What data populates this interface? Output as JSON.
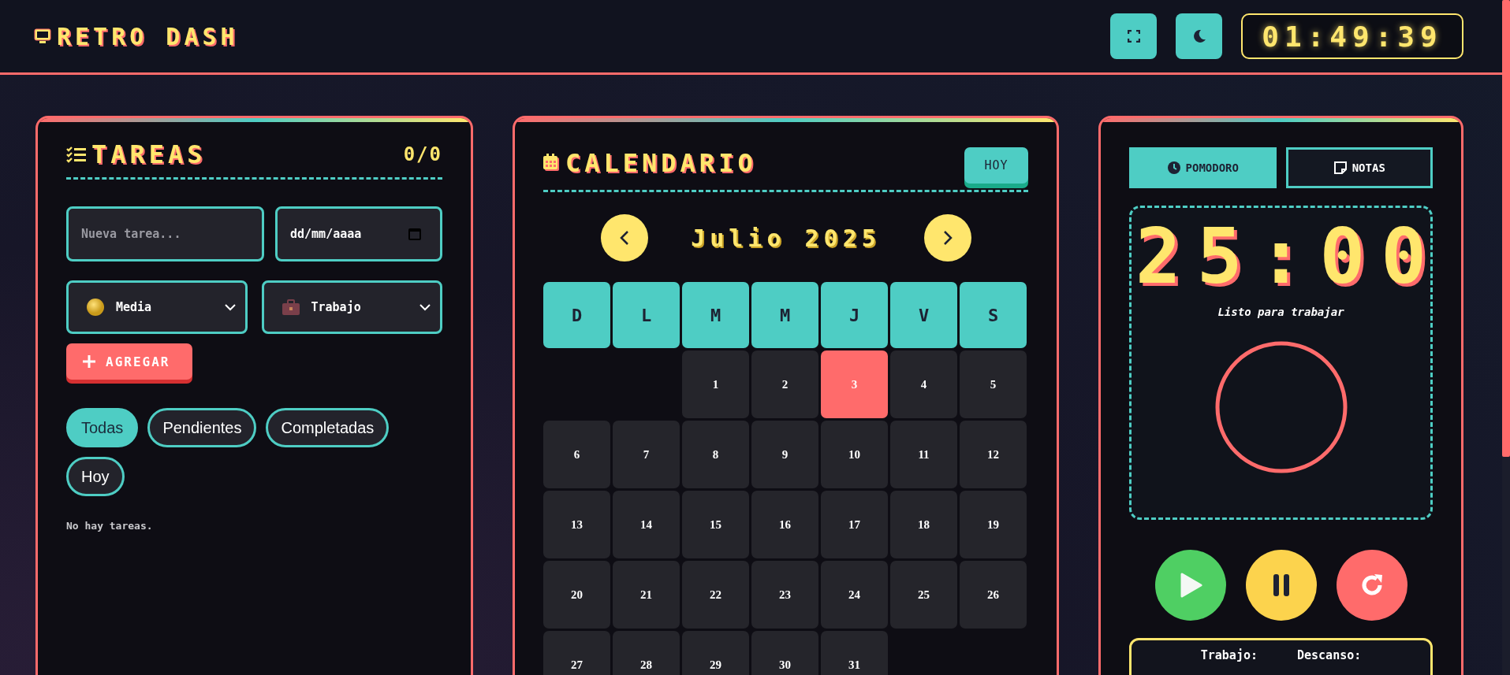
{
  "header": {
    "title": "RETRO DASH",
    "clock": "01:49:39"
  },
  "tasks": {
    "title": "TAREAS",
    "count": "0/0",
    "task_input": {
      "placeholder": "Nueva tarea..."
    },
    "date_input": {
      "placeholder": "dd/mm/aaaa"
    },
    "priority_select": {
      "value": "Media"
    },
    "category_select": {
      "value": "Trabajo"
    },
    "add_button": "AGREGAR",
    "filters": [
      {
        "label": "Todas",
        "selected": true
      },
      {
        "label": "Pendientes",
        "selected": false
      },
      {
        "label": "Completadas",
        "selected": false
      },
      {
        "label": "Hoy",
        "selected": false
      }
    ],
    "empty_message": "No hay tareas."
  },
  "calendar": {
    "title": "CALENDARIO",
    "today_button": "HOY",
    "month": "Julio 2025",
    "weekdays": [
      "D",
      "L",
      "M",
      "M",
      "J",
      "V",
      "S"
    ],
    "days": [
      {
        "kind": "blank"
      },
      {
        "kind": "blank"
      },
      {
        "kind": "day",
        "label": "1",
        "today": false
      },
      {
        "kind": "day",
        "label": "2",
        "today": false
      },
      {
        "kind": "day",
        "label": "3",
        "today": true
      },
      {
        "kind": "day",
        "label": "4",
        "today": false
      },
      {
        "kind": "day",
        "label": "5",
        "today": false
      },
      {
        "kind": "day",
        "label": "6",
        "today": false
      },
      {
        "kind": "day",
        "label": "7",
        "today": false
      },
      {
        "kind": "day",
        "label": "8",
        "today": false
      },
      {
        "kind": "day",
        "label": "9",
        "today": false
      },
      {
        "kind": "day",
        "label": "10",
        "today": false
      },
      {
        "kind": "day",
        "label": "11",
        "today": false
      },
      {
        "kind": "day",
        "label": "12",
        "today": false
      },
      {
        "kind": "day",
        "label": "13",
        "today": false
      },
      {
        "kind": "day",
        "label": "14",
        "today": false
      },
      {
        "kind": "day",
        "label": "15",
        "today": false
      },
      {
        "kind": "day",
        "label": "16",
        "today": false
      },
      {
        "kind": "day",
        "label": "17",
        "today": false
      },
      {
        "kind": "day",
        "label": "18",
        "today": false
      },
      {
        "kind": "day",
        "label": "19",
        "today": false
      },
      {
        "kind": "day",
        "label": "20",
        "today": false
      },
      {
        "kind": "day",
        "label": "21",
        "today": false
      },
      {
        "kind": "day",
        "label": "22",
        "today": false
      },
      {
        "kind": "day",
        "label": "23",
        "today": false
      },
      {
        "kind": "day",
        "label": "24",
        "today": false
      },
      {
        "kind": "day",
        "label": "25",
        "today": false
      },
      {
        "kind": "day",
        "label": "26",
        "today": false
      },
      {
        "kind": "day",
        "label": "27",
        "today": false
      },
      {
        "kind": "day",
        "label": "28",
        "today": false
      },
      {
        "kind": "day",
        "label": "29",
        "today": false
      },
      {
        "kind": "day",
        "label": "30",
        "today": false
      },
      {
        "kind": "day",
        "label": "31",
        "today": false
      }
    ]
  },
  "pomodoro": {
    "tabs": [
      {
        "label": "POMODORO",
        "selected": true
      },
      {
        "label": "NOTAS",
        "selected": false
      }
    ],
    "time": "25:00",
    "status": "Listo para trabajar",
    "stats": [
      "Trabajo:",
      "Descanso:"
    ]
  }
}
